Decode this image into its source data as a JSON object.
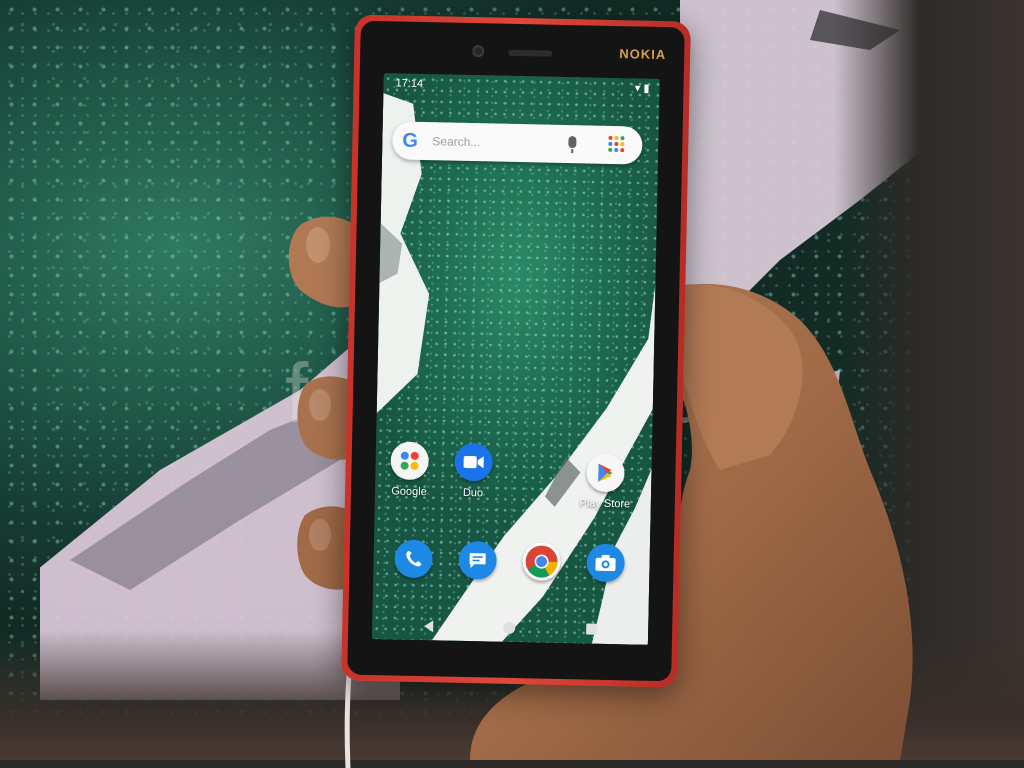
{
  "phone": {
    "brand": "NOKIA"
  },
  "watermark": "fonearena",
  "status_bar": {
    "time": "17:14"
  },
  "search": {
    "logo_letter": "G",
    "placeholder": "Search..."
  },
  "apps_row1": [
    {
      "label": "Google",
      "icon": "google-folder-icon"
    },
    {
      "label": "Duo",
      "icon": "duo-video-icon"
    },
    {
      "label": "Play Store",
      "icon": "play-store-icon"
    }
  ],
  "dock": [
    {
      "icon": "phone-icon"
    },
    {
      "icon": "messages-icon"
    },
    {
      "icon": "chrome-icon"
    },
    {
      "icon": "camera-icon"
    }
  ],
  "colors": {
    "phone_body": "#d23a2f",
    "brand_gold": "#d9a04a",
    "wallpaper_green": "#1e6b50"
  }
}
